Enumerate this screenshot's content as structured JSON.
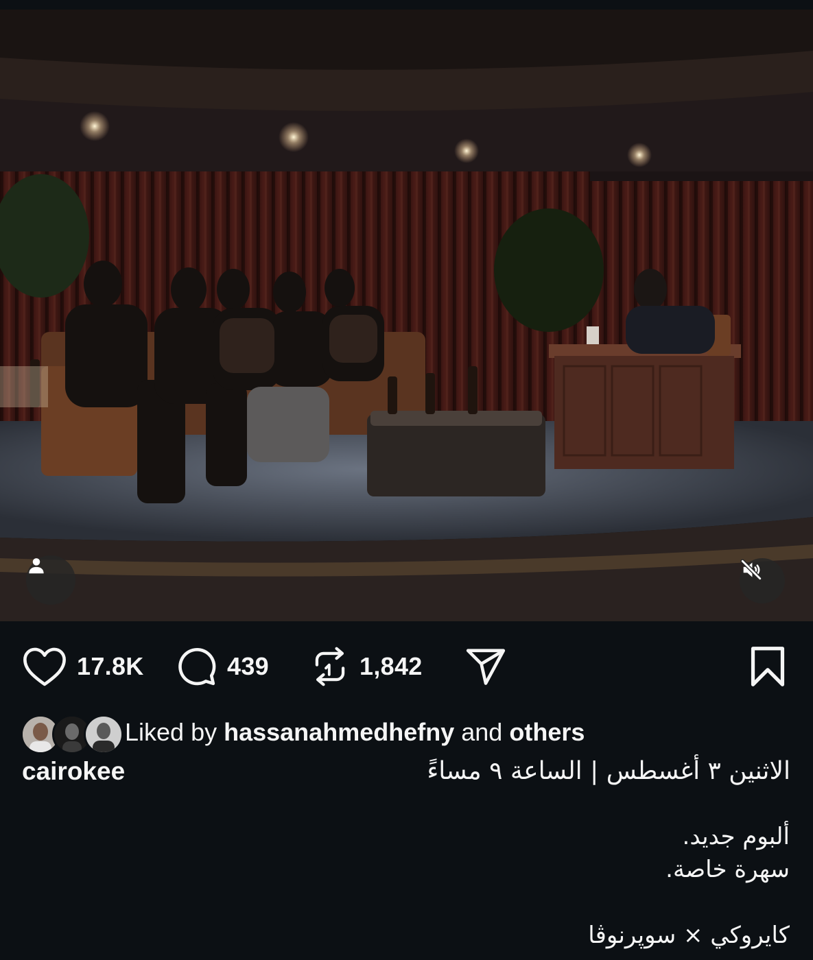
{
  "post": {
    "username": "cairokee",
    "date_line": "الاثنين ٣ أغسطس | الساعة ٩ مساءً",
    "caption_lines": [
      "ألبوم جديد.",
      "سهرة خاصة.",
      "",
      "كايروكي × سوپرنوڤا"
    ]
  },
  "video": {
    "tag_icon": "person-icon",
    "mute_icon": "speaker-muted-icon"
  },
  "actions": {
    "likes": "17.8K",
    "comments": "439",
    "reposts": "1,842",
    "like_icon": "heart-icon",
    "comment_icon": "comment-bubble-icon",
    "repost_icon": "repost-icon",
    "share_icon": "paper-plane-icon",
    "save_icon": "bookmark-icon"
  },
  "liked_by": {
    "prefix": "Liked by",
    "user": "hassanahmedhefny",
    "middle": "and",
    "suffix": "others"
  },
  "colors": {
    "background": "#0c1014",
    "text": "#f5f5f5"
  }
}
